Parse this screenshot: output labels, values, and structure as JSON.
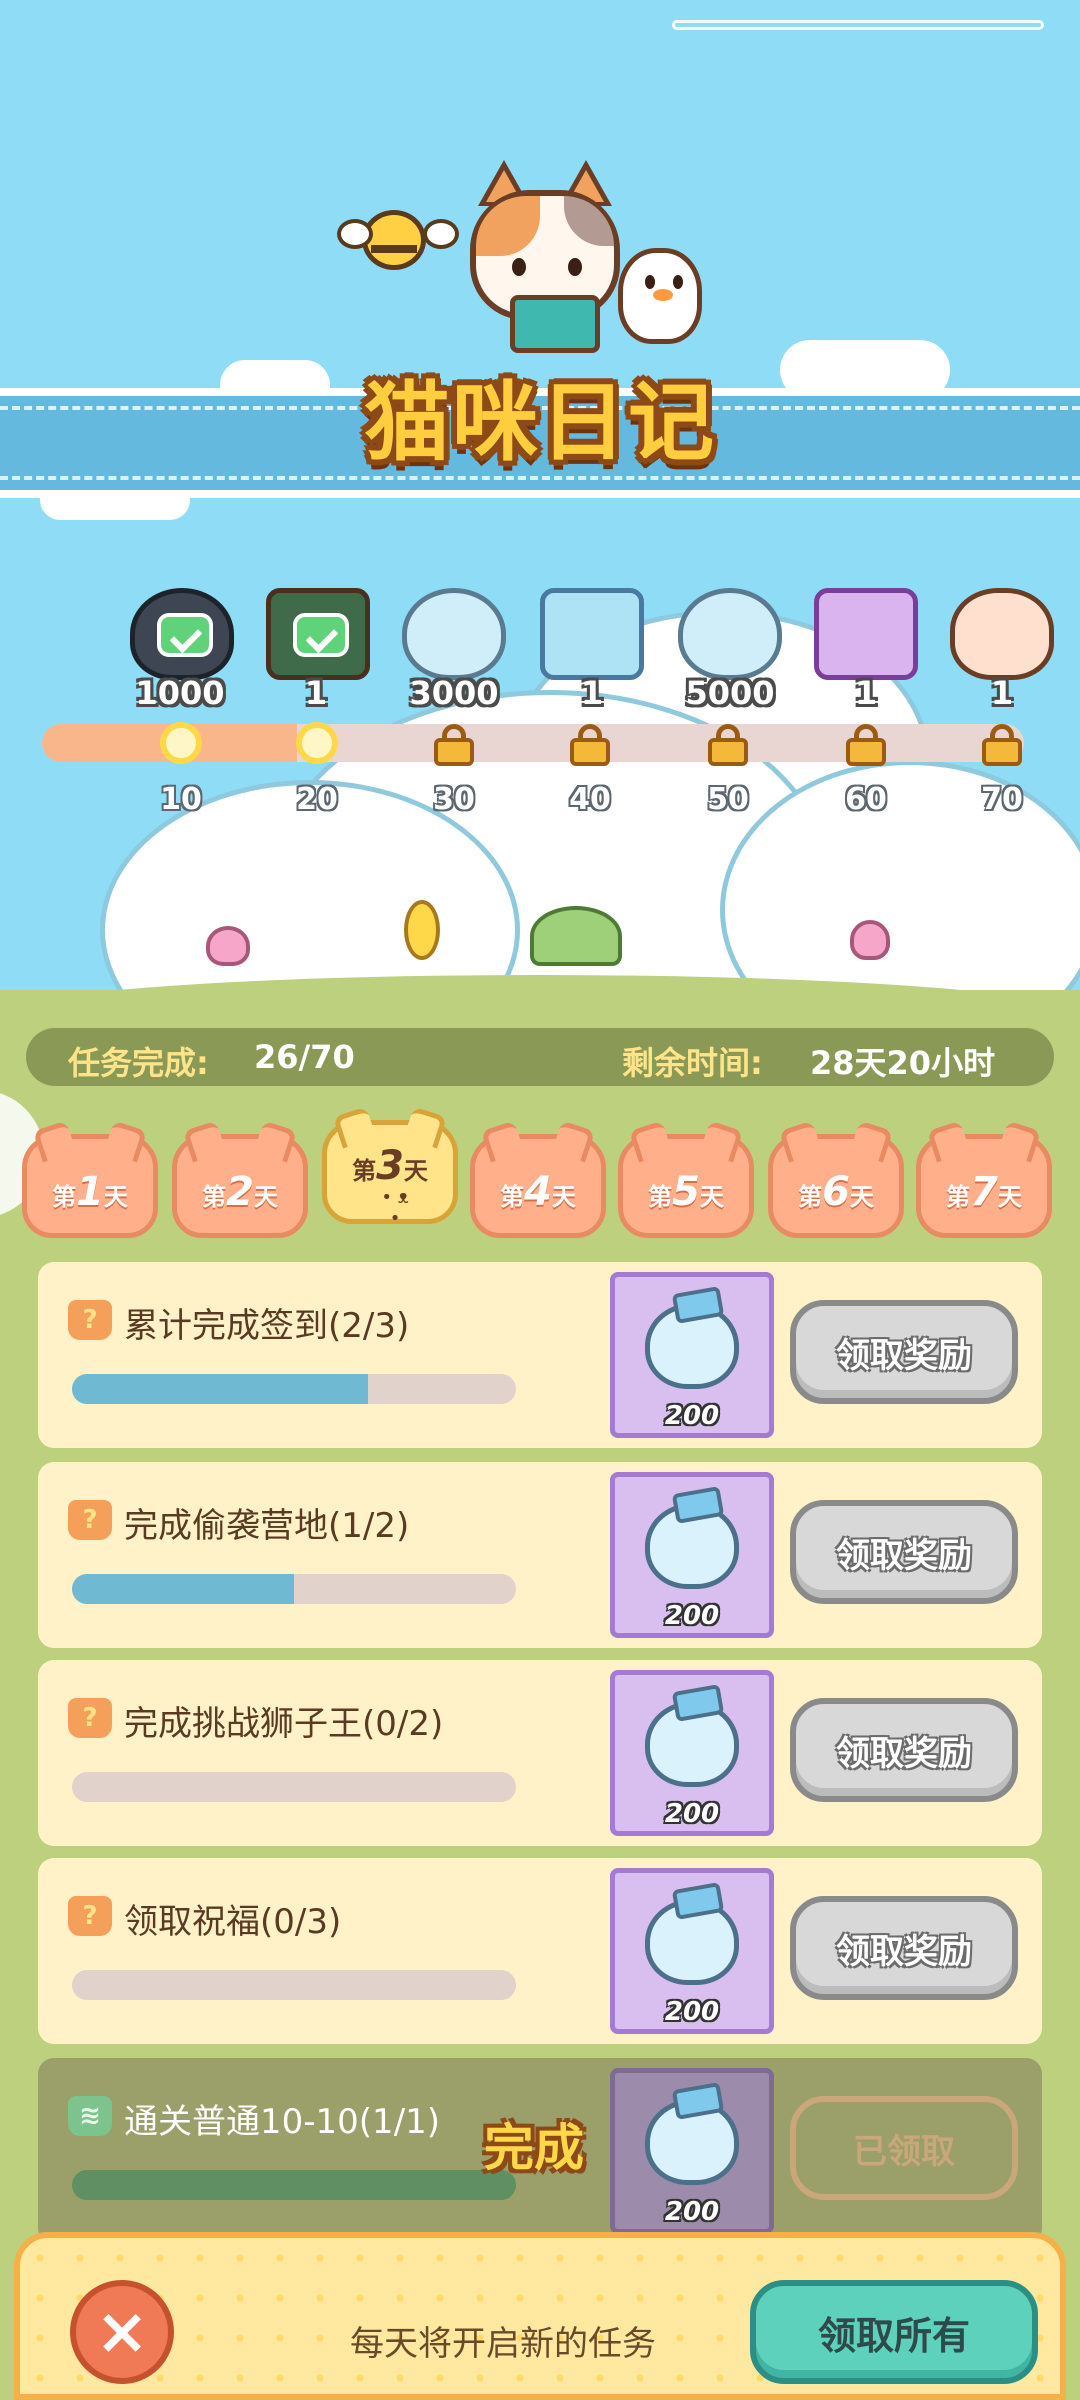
{
  "header": {
    "title": "猫咪日记"
  },
  "reward_track": {
    "rewards": [
      {
        "icon": "gem-pile-icon",
        "count": "1000",
        "claimed": true
      },
      {
        "icon": "green-chest-icon",
        "count": "1",
        "claimed": true
      },
      {
        "icon": "gem-bag-icon",
        "count": "3000",
        "claimed": false
      },
      {
        "icon": "blue-chest-icon",
        "count": "1",
        "claimed": false
      },
      {
        "icon": "gem-bag-icon",
        "count": "5000",
        "claimed": false
      },
      {
        "icon": "purple-chest-icon",
        "count": "1",
        "claimed": false
      },
      {
        "icon": "cat-avatar-icon",
        "count": "1",
        "claimed": false
      }
    ],
    "milestones": [
      "10",
      "20",
      "30",
      "40",
      "50",
      "60",
      "70"
    ],
    "progress_fraction": 0.26
  },
  "status": {
    "task_label": "任务完成:",
    "task_value": "26/70",
    "time_label": "剩余时间:",
    "time_value": "28天20小时"
  },
  "days": [
    {
      "prefix": "第",
      "num": "1",
      "suffix": "天"
    },
    {
      "prefix": "第",
      "num": "2",
      "suffix": "天"
    },
    {
      "prefix": "第",
      "num": "3",
      "suffix": "天",
      "active": true
    },
    {
      "prefix": "第",
      "num": "4",
      "suffix": "天"
    },
    {
      "prefix": "第",
      "num": "5",
      "suffix": "天"
    },
    {
      "prefix": "第",
      "num": "6",
      "suffix": "天"
    },
    {
      "prefix": "第",
      "num": "7",
      "suffix": "天"
    }
  ],
  "tasks": [
    {
      "title": "累计完成签到(2/3)",
      "progress": 0.667,
      "reward": "200",
      "button": "领取奖励",
      "done": false
    },
    {
      "title": "完成偷袭营地(1/2)",
      "progress": 0.5,
      "reward": "200",
      "button": "领取奖励",
      "done": false
    },
    {
      "title": "完成挑战狮子王(0/2)",
      "progress": 0,
      "reward": "200",
      "button": "领取奖励",
      "done": false
    },
    {
      "title": "领取祝福(0/3)",
      "progress": 0,
      "reward": "200",
      "button": "领取奖励",
      "done": false
    },
    {
      "title": "通关普通10-10(1/1)",
      "progress": 1,
      "reward": "200",
      "button": "已领取",
      "done": true,
      "stamp": "完成"
    }
  ],
  "footer": {
    "close_icon": "close-icon",
    "note": "每天将开启新的任务",
    "claim_all": "领取所有"
  },
  "colors": {
    "sky": "#8fdcf6",
    "grass": "#bcd07e",
    "accent_orange": "#f8b68a",
    "progress_blue": "#6fb9d3"
  }
}
